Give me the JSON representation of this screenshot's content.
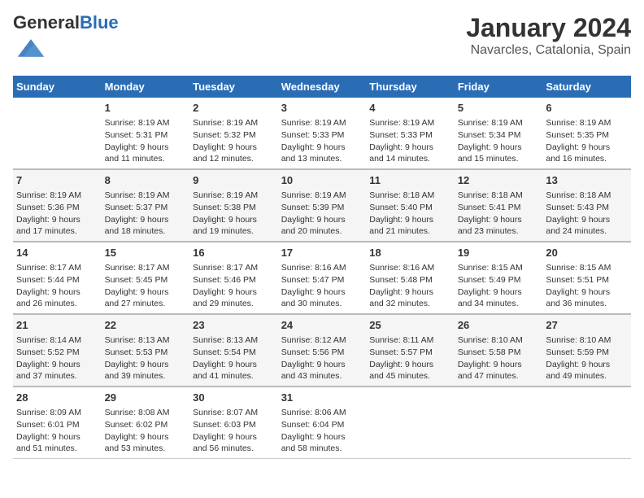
{
  "header": {
    "logo_general": "General",
    "logo_blue": "Blue",
    "main_title": "January 2024",
    "subtitle": "Navarcles, Catalonia, Spain"
  },
  "weekdays": [
    "Sunday",
    "Monday",
    "Tuesday",
    "Wednesday",
    "Thursday",
    "Friday",
    "Saturday"
  ],
  "weeks": [
    [
      {
        "day": "",
        "info": ""
      },
      {
        "day": "1",
        "info": "Sunrise: 8:19 AM\nSunset: 5:31 PM\nDaylight: 9 hours\nand 11 minutes."
      },
      {
        "day": "2",
        "info": "Sunrise: 8:19 AM\nSunset: 5:32 PM\nDaylight: 9 hours\nand 12 minutes."
      },
      {
        "day": "3",
        "info": "Sunrise: 8:19 AM\nSunset: 5:33 PM\nDaylight: 9 hours\nand 13 minutes."
      },
      {
        "day": "4",
        "info": "Sunrise: 8:19 AM\nSunset: 5:33 PM\nDaylight: 9 hours\nand 14 minutes."
      },
      {
        "day": "5",
        "info": "Sunrise: 8:19 AM\nSunset: 5:34 PM\nDaylight: 9 hours\nand 15 minutes."
      },
      {
        "day": "6",
        "info": "Sunrise: 8:19 AM\nSunset: 5:35 PM\nDaylight: 9 hours\nand 16 minutes."
      }
    ],
    [
      {
        "day": "7",
        "info": "Sunrise: 8:19 AM\nSunset: 5:36 PM\nDaylight: 9 hours\nand 17 minutes."
      },
      {
        "day": "8",
        "info": "Sunrise: 8:19 AM\nSunset: 5:37 PM\nDaylight: 9 hours\nand 18 minutes."
      },
      {
        "day": "9",
        "info": "Sunrise: 8:19 AM\nSunset: 5:38 PM\nDaylight: 9 hours\nand 19 minutes."
      },
      {
        "day": "10",
        "info": "Sunrise: 8:19 AM\nSunset: 5:39 PM\nDaylight: 9 hours\nand 20 minutes."
      },
      {
        "day": "11",
        "info": "Sunrise: 8:18 AM\nSunset: 5:40 PM\nDaylight: 9 hours\nand 21 minutes."
      },
      {
        "day": "12",
        "info": "Sunrise: 8:18 AM\nSunset: 5:41 PM\nDaylight: 9 hours\nand 23 minutes."
      },
      {
        "day": "13",
        "info": "Sunrise: 8:18 AM\nSunset: 5:43 PM\nDaylight: 9 hours\nand 24 minutes."
      }
    ],
    [
      {
        "day": "14",
        "info": "Sunrise: 8:17 AM\nSunset: 5:44 PM\nDaylight: 9 hours\nand 26 minutes."
      },
      {
        "day": "15",
        "info": "Sunrise: 8:17 AM\nSunset: 5:45 PM\nDaylight: 9 hours\nand 27 minutes."
      },
      {
        "day": "16",
        "info": "Sunrise: 8:17 AM\nSunset: 5:46 PM\nDaylight: 9 hours\nand 29 minutes."
      },
      {
        "day": "17",
        "info": "Sunrise: 8:16 AM\nSunset: 5:47 PM\nDaylight: 9 hours\nand 30 minutes."
      },
      {
        "day": "18",
        "info": "Sunrise: 8:16 AM\nSunset: 5:48 PM\nDaylight: 9 hours\nand 32 minutes."
      },
      {
        "day": "19",
        "info": "Sunrise: 8:15 AM\nSunset: 5:49 PM\nDaylight: 9 hours\nand 34 minutes."
      },
      {
        "day": "20",
        "info": "Sunrise: 8:15 AM\nSunset: 5:51 PM\nDaylight: 9 hours\nand 36 minutes."
      }
    ],
    [
      {
        "day": "21",
        "info": "Sunrise: 8:14 AM\nSunset: 5:52 PM\nDaylight: 9 hours\nand 37 minutes."
      },
      {
        "day": "22",
        "info": "Sunrise: 8:13 AM\nSunset: 5:53 PM\nDaylight: 9 hours\nand 39 minutes."
      },
      {
        "day": "23",
        "info": "Sunrise: 8:13 AM\nSunset: 5:54 PM\nDaylight: 9 hours\nand 41 minutes."
      },
      {
        "day": "24",
        "info": "Sunrise: 8:12 AM\nSunset: 5:56 PM\nDaylight: 9 hours\nand 43 minutes."
      },
      {
        "day": "25",
        "info": "Sunrise: 8:11 AM\nSunset: 5:57 PM\nDaylight: 9 hours\nand 45 minutes."
      },
      {
        "day": "26",
        "info": "Sunrise: 8:10 AM\nSunset: 5:58 PM\nDaylight: 9 hours\nand 47 minutes."
      },
      {
        "day": "27",
        "info": "Sunrise: 8:10 AM\nSunset: 5:59 PM\nDaylight: 9 hours\nand 49 minutes."
      }
    ],
    [
      {
        "day": "28",
        "info": "Sunrise: 8:09 AM\nSunset: 6:01 PM\nDaylight: 9 hours\nand 51 minutes."
      },
      {
        "day": "29",
        "info": "Sunrise: 8:08 AM\nSunset: 6:02 PM\nDaylight: 9 hours\nand 53 minutes."
      },
      {
        "day": "30",
        "info": "Sunrise: 8:07 AM\nSunset: 6:03 PM\nDaylight: 9 hours\nand 56 minutes."
      },
      {
        "day": "31",
        "info": "Sunrise: 8:06 AM\nSunset: 6:04 PM\nDaylight: 9 hours\nand 58 minutes."
      },
      {
        "day": "",
        "info": ""
      },
      {
        "day": "",
        "info": ""
      },
      {
        "day": "",
        "info": ""
      }
    ]
  ]
}
